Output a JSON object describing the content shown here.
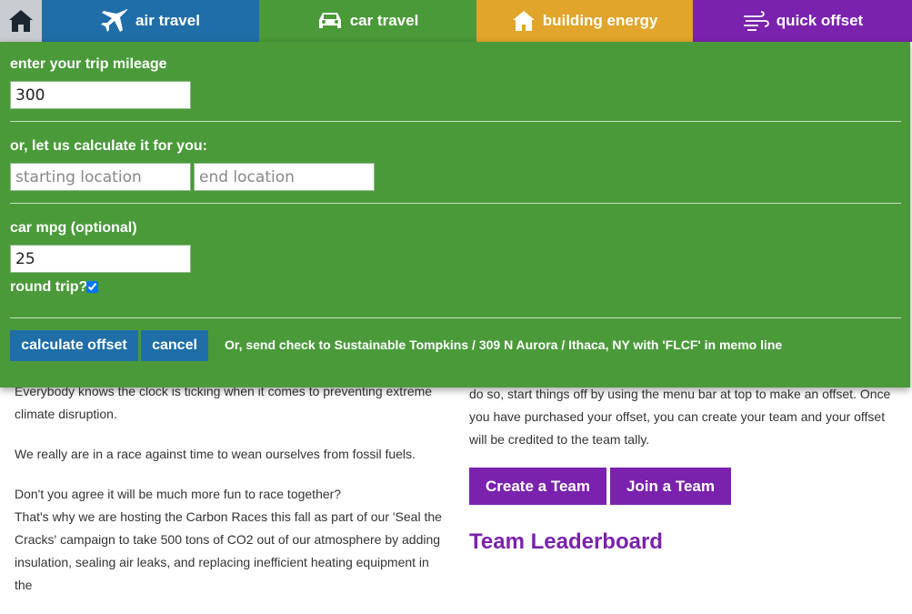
{
  "nav": {
    "air": "air travel",
    "car": "car travel",
    "building": "building energy",
    "quick": "quick offset"
  },
  "panel": {
    "mileage_label": "enter your trip mileage",
    "mileage_value": "300",
    "calc_label": "or, let us calculate it for you:",
    "start_placeholder": "starting location",
    "end_placeholder": "end location",
    "mpg_label": "car mpg (optional)",
    "mpg_value": "25",
    "round_trip_label": "round trip?",
    "round_trip_checked": true,
    "calculate_button": "calculate offset",
    "cancel_button": "cancel",
    "check_note": "Or, send check to Sustainable Tompkins / 309 N Aurora / Ithaca, NY with 'FLCF' in memo line"
  },
  "page": {
    "left_paragraphs": [
      "Everybody knows the clock is ticking when it comes to preventing extreme climate disruption.",
      "We really are in a race against time to wean ourselves from fossil fuels.",
      "Don't you agree it will be much more fun to race together?"
    ],
    "left_paragraph_4": "That's why we are hosting the Carbon Races this fall as part of our 'Seal the Cracks' campaign to take 500 tons of CO2 out of our atmosphere by adding insulation, sealing air leaks, and replacing inefficient heating equipment in the",
    "right_text": "do so, start things off by using the menu bar at top to make an offset. Once you have purchased your offset, you can create your team and your offset will be credited to the team tally.",
    "create_team": "Create a Team",
    "join_team": "Join a Team",
    "leaderboard_title": "Team Leaderboard"
  }
}
